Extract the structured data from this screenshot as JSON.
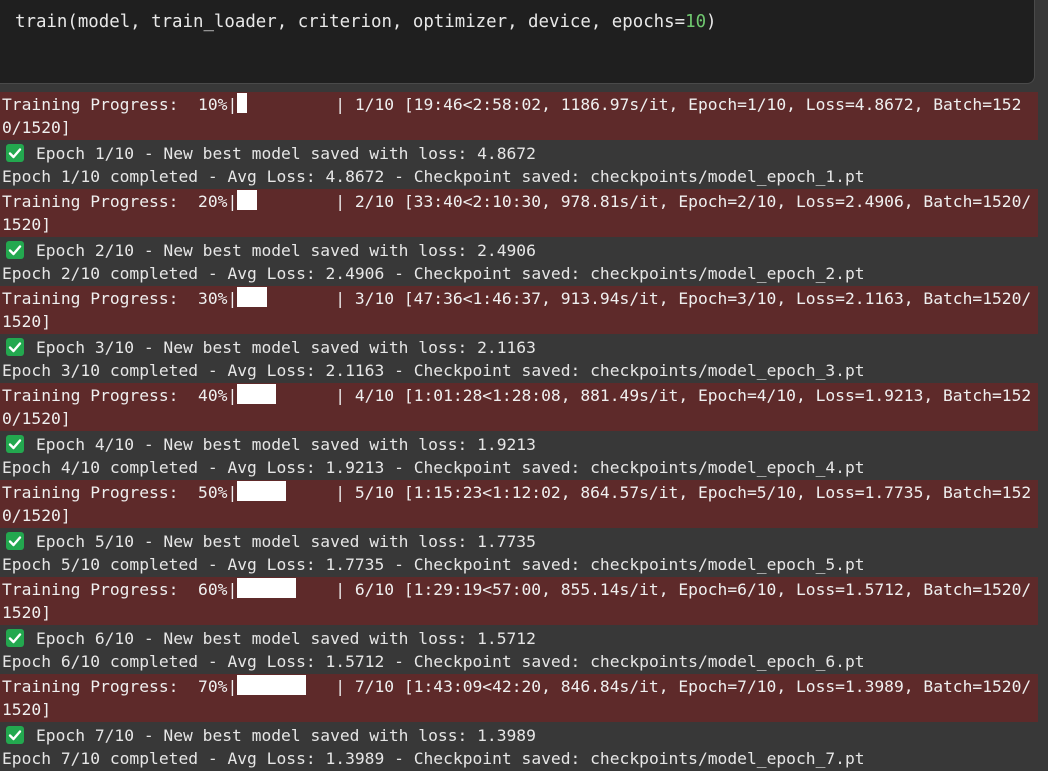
{
  "code_cell": {
    "prefix": "train(model, train_loader, criterion, optimizer, device, epochs=",
    "epochs_value": "10",
    "suffix": ")"
  },
  "epochs": [
    {
      "progress_label": "Training Progress:  10%|",
      "progress_fraction": 0.1,
      "progress_tail": "| 1/10 [19:46<2:58:02, 1186.97s/it, Epoch=1/10, Loss=4.8672, Batch=1520/1520]",
      "best_msg": "Epoch 1/10 - New best model saved with loss: 4.8672",
      "completed_msg": "Epoch 1/10 completed - Avg Loss: 4.8672 - Checkpoint saved: checkpoints/model_epoch_1.pt"
    },
    {
      "progress_label": "Training Progress:  20%|",
      "progress_fraction": 0.2,
      "progress_tail": "| 2/10 [33:40<2:10:30, 978.81s/it, Epoch=2/10, Loss=2.4906, Batch=1520/1520]",
      "best_msg": "Epoch 2/10 - New best model saved with loss: 2.4906",
      "completed_msg": "Epoch 2/10 completed - Avg Loss: 2.4906 - Checkpoint saved: checkpoints/model_epoch_2.pt"
    },
    {
      "progress_label": "Training Progress:  30%|",
      "progress_fraction": 0.3,
      "progress_tail": "| 3/10 [47:36<1:46:37, 913.94s/it, Epoch=3/10, Loss=2.1163, Batch=1520/1520]",
      "best_msg": "Epoch 3/10 - New best model saved with loss: 2.1163",
      "completed_msg": "Epoch 3/10 completed - Avg Loss: 2.1163 - Checkpoint saved: checkpoints/model_epoch_3.pt"
    },
    {
      "progress_label": "Training Progress:  40%|",
      "progress_fraction": 0.4,
      "progress_tail": "| 4/10 [1:01:28<1:28:08, 881.49s/it, Epoch=4/10, Loss=1.9213, Batch=1520/1520]",
      "best_msg": "Epoch 4/10 - New best model saved with loss: 1.9213",
      "completed_msg": "Epoch 4/10 completed - Avg Loss: 1.9213 - Checkpoint saved: checkpoints/model_epoch_4.pt"
    },
    {
      "progress_label": "Training Progress:  50%|",
      "progress_fraction": 0.5,
      "progress_tail": "| 5/10 [1:15:23<1:12:02, 864.57s/it, Epoch=5/10, Loss=1.7735, Batch=1520/1520]",
      "best_msg": "Epoch 5/10 - New best model saved with loss: 1.7735",
      "completed_msg": "Epoch 5/10 completed - Avg Loss: 1.7735 - Checkpoint saved: checkpoints/model_epoch_5.pt"
    },
    {
      "progress_label": "Training Progress:  60%|",
      "progress_fraction": 0.6,
      "progress_tail": "| 6/10 [1:29:19<57:00, 855.14s/it, Epoch=6/10, Loss=1.5712, Batch=1520/1520]",
      "best_msg": "Epoch 6/10 - New best model saved with loss: 1.5712",
      "completed_msg": "Epoch 6/10 completed - Avg Loss: 1.5712 - Checkpoint saved: checkpoints/model_epoch_6.pt"
    },
    {
      "progress_label": "Training Progress:  70%|",
      "progress_fraction": 0.7,
      "progress_tail": "| 7/10 [1:43:09<42:20, 846.84s/it, Epoch=7/10, Loss=1.3989, Batch=1520/1520]",
      "best_msg": "Epoch 7/10 - New best model saved with loss: 1.3989",
      "completed_msg": "Epoch 7/10 completed - Avg Loss: 1.3989 - Checkpoint saved: checkpoints/model_epoch_7.pt"
    }
  ],
  "colors": {
    "progress_bg": "#5e2a2a",
    "check_bg": "#23a84f",
    "number_literal": "#6fc76f"
  },
  "icons": {
    "best_model": "check-icon"
  }
}
